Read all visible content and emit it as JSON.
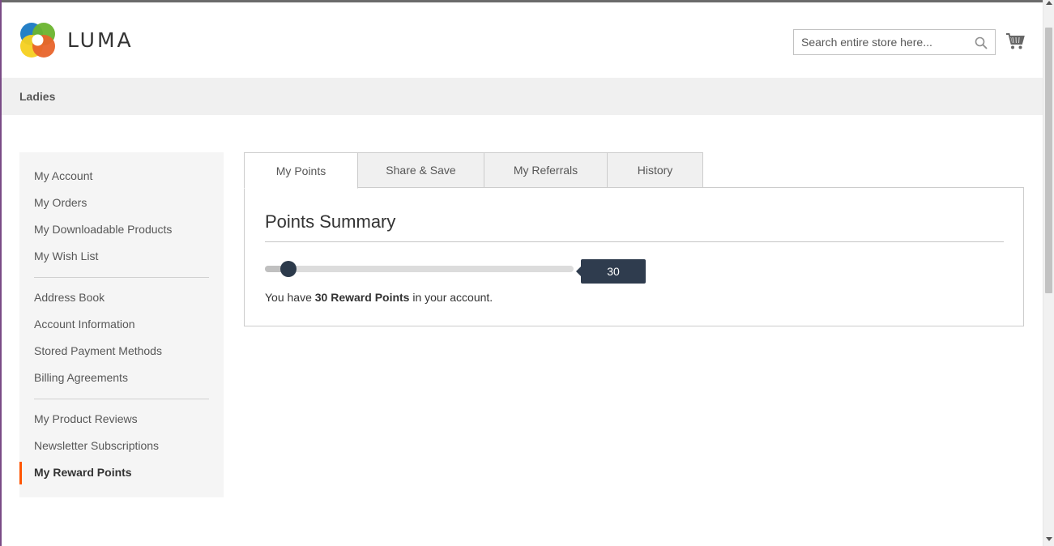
{
  "brand": {
    "name": "LUMA",
    "accent_color": "#ff5501"
  },
  "header": {
    "search": {
      "placeholder": "Search entire store here...",
      "value": ""
    },
    "icons": {
      "search": "search-icon",
      "cart": "cart-icon"
    }
  },
  "nav": {
    "items": [
      {
        "label": "Ladies"
      }
    ]
  },
  "sidebar": {
    "groups": [
      [
        "My Account",
        "My Orders",
        "My Downloadable Products",
        "My Wish List"
      ],
      [
        "Address Book",
        "Account Information",
        "Stored Payment Methods",
        "Billing Agreements"
      ],
      [
        "My Product Reviews",
        "Newsletter Subscriptions",
        "My Reward Points"
      ]
    ],
    "active": "My Reward Points"
  },
  "tabs": [
    {
      "label": "My Points",
      "active": true
    },
    {
      "label": "Share & Save",
      "active": false
    },
    {
      "label": "My Referrals",
      "active": false
    },
    {
      "label": "History",
      "active": false
    }
  ],
  "points_summary": {
    "title": "Points Summary",
    "slider": {
      "value": 30,
      "fill_fraction": 0.05
    },
    "bubble_value": "30",
    "text_prefix": "You have ",
    "text_bold": "30 Reward Points",
    "text_suffix": " in your account."
  }
}
